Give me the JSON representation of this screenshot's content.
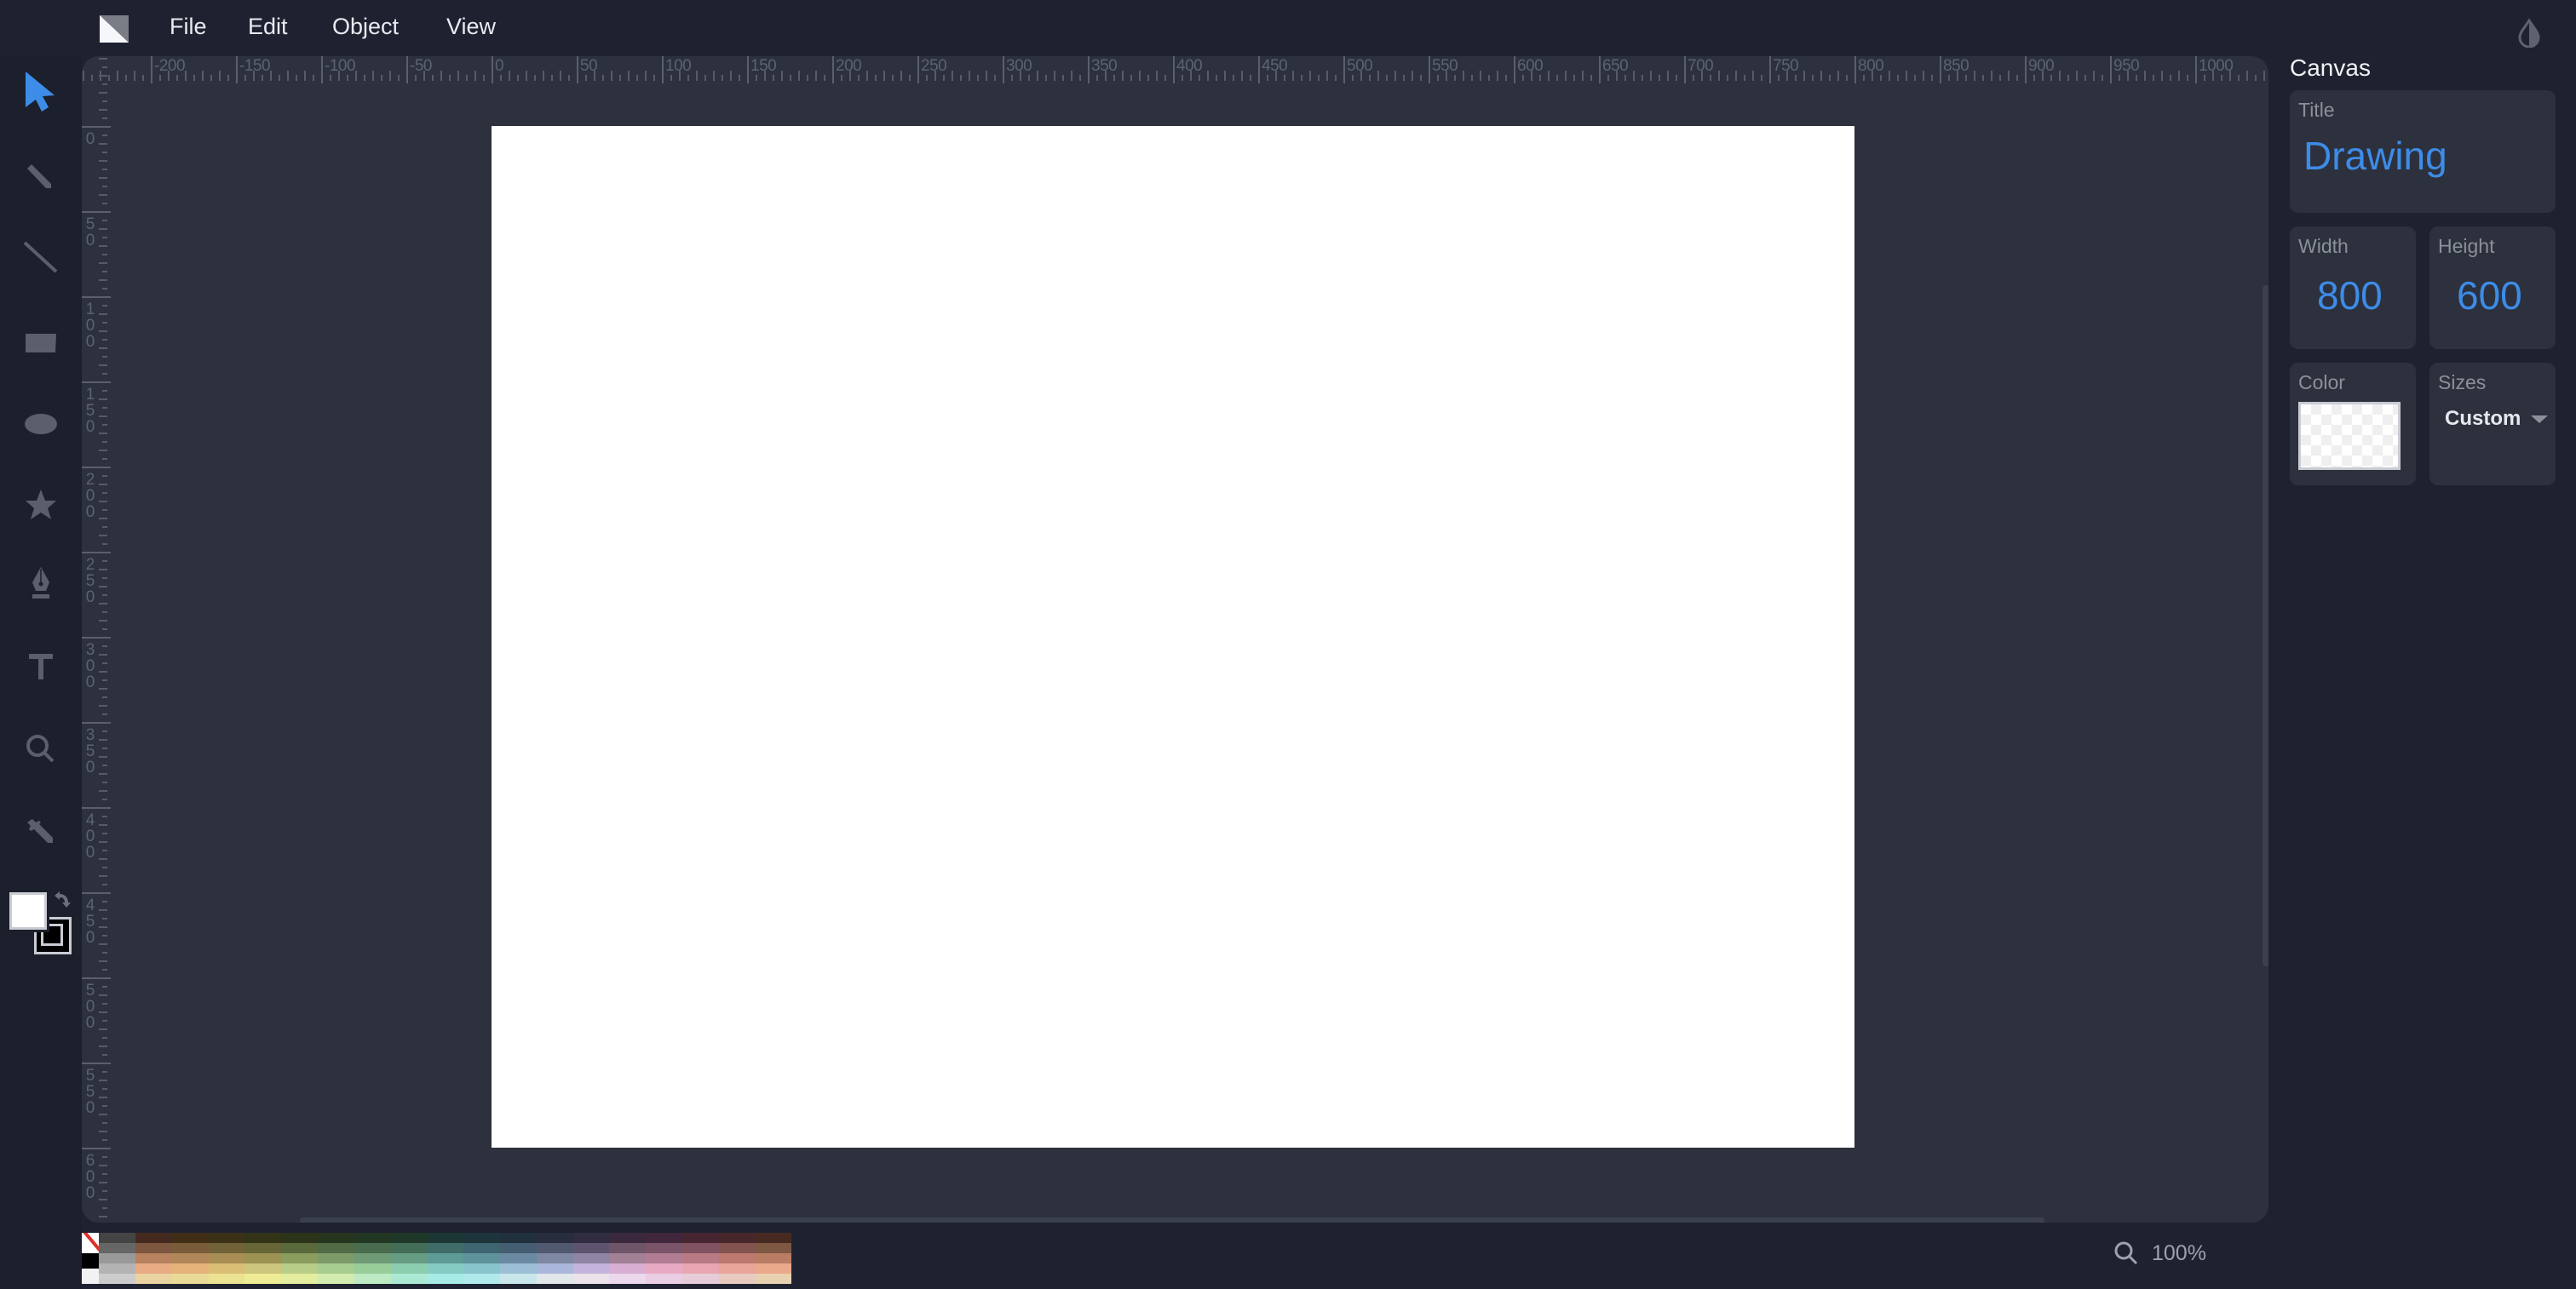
{
  "app": {
    "logo": "method-draw-logo",
    "theme_icon": "contrast-drop-icon"
  },
  "menu": {
    "items": [
      {
        "label": "File"
      },
      {
        "label": "Edit"
      },
      {
        "label": "Object"
      },
      {
        "label": "View"
      }
    ]
  },
  "toolbar": {
    "tools": [
      {
        "name": "select",
        "icon": "arrow-cursor-icon",
        "active": true
      },
      {
        "name": "pencil",
        "icon": "pencil-icon",
        "active": false
      },
      {
        "name": "line",
        "icon": "line-icon",
        "active": false
      },
      {
        "name": "rectangle",
        "icon": "rectangle-icon",
        "active": false
      },
      {
        "name": "ellipse",
        "icon": "ellipse-icon",
        "active": false
      },
      {
        "name": "star",
        "icon": "star-icon",
        "active": false
      },
      {
        "name": "pen",
        "icon": "pen-nib-icon",
        "active": false
      },
      {
        "name": "text",
        "icon": "text-icon",
        "active": false
      },
      {
        "name": "zoom",
        "icon": "magnifier-icon",
        "active": false
      },
      {
        "name": "eyedropper",
        "icon": "eyedropper-icon",
        "active": false
      }
    ],
    "fill_color": "#ffffff",
    "stroke_color": "#000000",
    "active_color": "#3d8ce8",
    "inactive_color": "#5b5f6c"
  },
  "rulers": {
    "top_labels": [
      "-200",
      "-150",
      "-100",
      "-50",
      "0",
      "50",
      "100",
      "150",
      "200",
      "250",
      "300",
      "350",
      "400",
      "450",
      "500",
      "550",
      "600",
      "650",
      "700",
      "750",
      "800",
      "850",
      "900",
      "950",
      "1000"
    ],
    "left_labels": [
      "0",
      "50",
      "100",
      "150",
      "200",
      "250",
      "300",
      "350",
      "400",
      "450",
      "500",
      "550",
      "600"
    ]
  },
  "canvas": {
    "background": "#ffffff"
  },
  "palette": {
    "special": [
      "none",
      "#000000",
      "#ffffff"
    ],
    "grays": [
      "#444444",
      "#666666",
      "#999999",
      "#b3b3b3",
      "#cccccc"
    ],
    "columns": [
      [
        "#442a1e",
        "#7d5640",
        "#b6825f",
        "#e8ab83",
        "#e9d3a1"
      ],
      [
        "#412e17",
        "#7a5b3a",
        "#b08758",
        "#e5b278",
        "#e9da98"
      ],
      [
        "#3b3117",
        "#716237",
        "#a88e55",
        "#dbbe75",
        "#ebe292"
      ],
      [
        "#323317",
        "#686536",
        "#9b9254",
        "#cdc77d",
        "#eeec94"
      ],
      [
        "#2b3319",
        "#5b6a3c",
        "#8a9c5e",
        "#b8cd87",
        "#e4eca0"
      ],
      [
        "#26351d",
        "#506b45",
        "#7d9a6a",
        "#a7cc8f",
        "#d2ecaf"
      ],
      [
        "#213623",
        "#496c4f",
        "#6f9c76",
        "#98cd9a",
        "#bdeac2"
      ],
      [
        "#1f3728",
        "#436d57",
        "#669d84",
        "#8bcdaf",
        "#ace9d5"
      ],
      [
        "#1c3733",
        "#3f6c68",
        "#5e9b96",
        "#85cbc2",
        "#a7eae6"
      ],
      [
        "#1d343a",
        "#3e6670",
        "#5e9399",
        "#88c4cc",
        "#b0e9ec"
      ],
      [
        "#21303d",
        "#445d71",
        "#6a8aa1",
        "#9dbfd6",
        "#c9e7ea"
      ],
      [
        "#282d3e",
        "#515970",
        "#7f88a2",
        "#aab6db",
        "#e1e6ea"
      ],
      [
        "#322c40",
        "#5f5470",
        "#8e84a4",
        "#c4b3db",
        "#ebe2ea"
      ],
      [
        "#3a293d",
        "#6f5568",
        "#a28096",
        "#d8aed2",
        "#ebd8ec"
      ],
      [
        "#40273b",
        "#7a5469",
        "#b07d93",
        "#e7aac3",
        "#e9cde3"
      ],
      [
        "#462731",
        "#815261",
        "#b87a84",
        "#e8a6b2",
        "#e6ccd8"
      ],
      [
        "#47282a",
        "#83544f",
        "#bd786f",
        "#e9a599",
        "#e8cac0"
      ],
      [
        "#462a21",
        "#7f5843",
        "#b97d65",
        "#e9a98a",
        "#e8d1b0"
      ]
    ]
  },
  "zoom": {
    "icon": "magnifier-icon",
    "value": "100%"
  },
  "panel": {
    "title": "Canvas",
    "title_field": {
      "label": "Title",
      "value": "Drawing"
    },
    "width_field": {
      "label": "Width",
      "value": "800"
    },
    "height_field": {
      "label": "Height",
      "value": "600"
    },
    "color_field": {
      "label": "Color",
      "value": "transparent"
    },
    "sizes_field": {
      "label": "Sizes",
      "value": "Custom"
    }
  }
}
